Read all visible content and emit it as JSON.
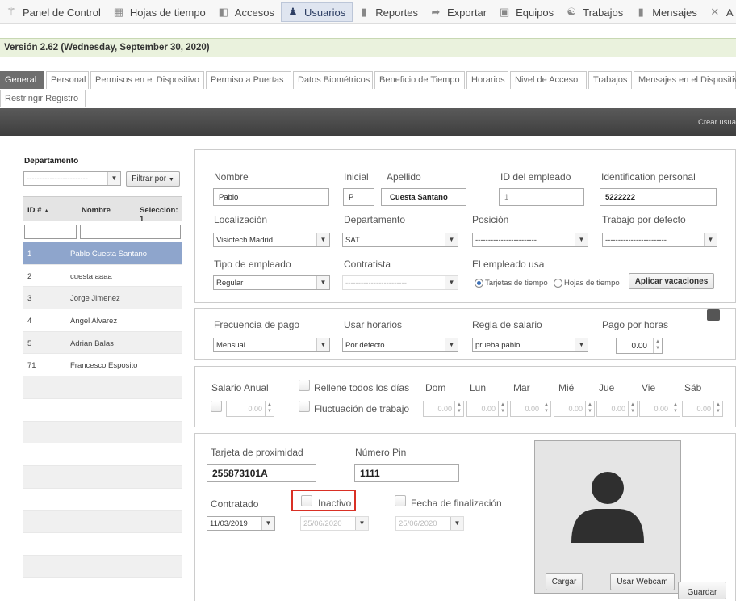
{
  "nav": [
    {
      "label": "Panel de Control",
      "icon": "dashboard-icon"
    },
    {
      "label": "Hojas de tiempo",
      "icon": "timesheet-icon"
    },
    {
      "label": "Accesos",
      "icon": "door-icon"
    },
    {
      "label": "Usuarios",
      "icon": "user-icon"
    },
    {
      "label": "Reportes",
      "icon": "bar-chart-icon"
    },
    {
      "label": "Exportar",
      "icon": "export-icon"
    },
    {
      "label": "Equipos",
      "icon": "device-icon"
    },
    {
      "label": "Trabajos",
      "icon": "worker-icon"
    },
    {
      "label": "Mensajes",
      "icon": "message-icon"
    },
    {
      "label": "A",
      "icon": "tools-icon"
    }
  ],
  "version": "Versión 2.62 (Wednesday, September 30, 2020)",
  "tabs": [
    "General",
    "Personal",
    "Permisos en el Dispositivo",
    "Permiso a Puertas",
    "Datos Biométricos",
    "Beneficio de Tiempo",
    "Horarios",
    "Nivel de Acceso",
    "Trabajos",
    "Mensajes en el Dispositivo",
    "Restringir Registro"
  ],
  "create_user": "Crear usua",
  "left": {
    "department_label": "Departamento",
    "department_value": "------------------------",
    "filter_button": "Filtrar por",
    "columns": {
      "id": "ID #",
      "name": "Nombre",
      "selection": "Selección: 1"
    },
    "rows": [
      {
        "id": "1",
        "name": "Pablo Cuesta Santano"
      },
      {
        "id": "2",
        "name": "cuesta aaaa"
      },
      {
        "id": "3",
        "name": "Jorge Jimenez"
      },
      {
        "id": "4",
        "name": "Angel Alvarez"
      },
      {
        "id": "5",
        "name": "Adrian Balas"
      },
      {
        "id": "71",
        "name": "Francesco Esposito"
      }
    ]
  },
  "form": {
    "nombre_label": "Nombre",
    "nombre": "Pablo",
    "inicial_label": "Inicial",
    "inicial": "P",
    "apellido_label": "Apellido",
    "apellido": "Cuesta Santano",
    "id_empleado_label": "ID del empleado",
    "id_empleado": "1",
    "ident_label": "Identification personal",
    "ident": "5222222",
    "localizacion_label": "Localización",
    "localizacion": "Visiotech Madrid",
    "departamento_label": "Departamento",
    "departamento": "SAT",
    "posicion_label": "Posición",
    "posicion": "------------------------",
    "trabajo_label": "Trabajo por defecto",
    "trabajo": "------------------------",
    "tipo_label": "Tipo de empleado",
    "tipo": "Regular",
    "contratista_label": "Contratista",
    "contratista": "------------------------",
    "usa_label": "El empleado usa",
    "radio1": "Tarjetas de tiempo",
    "radio2": "Hojas de tiempo",
    "vacaciones_button": "Aplicar vacaciones"
  },
  "pay": {
    "frecuencia_label": "Frecuencia de pago",
    "frecuencia": "Mensual",
    "horarios_label": "Usar horarios",
    "horarios": "Por defecto",
    "regla_label": "Regla de salario",
    "regla": "prueba pablo",
    "hora_label": "Pago por horas",
    "hora": "0.00"
  },
  "salary": {
    "anual_label": "Salario Anual",
    "anual": "0.00",
    "rellene_label": "Rellene todos los días",
    "fluct_label": "Fluctuación de trabajo",
    "days": [
      "Dom",
      "Lun",
      "Mar",
      "Mié",
      "Jue",
      "Vie",
      "Sáb"
    ],
    "day_value": "0.00"
  },
  "card": {
    "tarjeta_label": "Tarjeta de proximidad",
    "tarjeta": "255873101A",
    "pin_label": "Número Pin",
    "pin": "1111",
    "contratado_label": "Contratado",
    "contratado": "11/03/2019",
    "inactivo_label": "Inactivo",
    "fin_label": "Fecha de finalización",
    "date_disabled1": "25/06/2020",
    "date_disabled2": "25/06/2020",
    "cargar_button": "Cargar",
    "webcam_button": "Usar Webcam",
    "guardar_button": "Guardar"
  }
}
